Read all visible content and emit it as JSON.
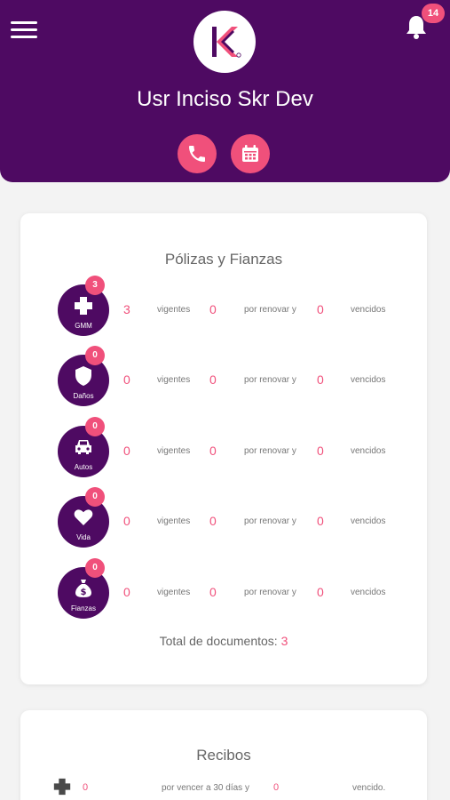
{
  "header": {
    "user_name": "Usr Inciso Skr Dev",
    "notifications_count": "14",
    "logo_letter": "K",
    "colors": {
      "primary": "#4e0a62",
      "accent": "#f0507b"
    }
  },
  "polizas": {
    "title": "Pólizas y Fianzas",
    "vigentes_label": "vigentes",
    "renovar_label": "por renovar y",
    "vencidos_label": "vencidos",
    "rows": [
      {
        "name": "GMM",
        "icon": "medical-cross-icon",
        "badge": "3",
        "vigentes": "3",
        "renovar": "0",
        "vencidos": "0"
      },
      {
        "name": "Daños",
        "icon": "shield-icon",
        "badge": "0",
        "vigentes": "0",
        "renovar": "0",
        "vencidos": "0"
      },
      {
        "name": "Autos",
        "icon": "car-icon",
        "badge": "0",
        "vigentes": "0",
        "renovar": "0",
        "vencidos": "0"
      },
      {
        "name": "Vida",
        "icon": "heart-icon",
        "badge": "0",
        "vigentes": "0",
        "renovar": "0",
        "vencidos": "0"
      },
      {
        "name": "Fianzas",
        "icon": "money-bag-icon",
        "badge": "0",
        "vigentes": "0",
        "renovar": "0",
        "vencidos": "0"
      }
    ],
    "total_label": "Total de documentos:",
    "total_value": "3"
  },
  "recibos": {
    "title": "Recibos",
    "row": {
      "icon": "medical-cross-icon",
      "value1": "0",
      "label1": "por vencer a 30 días y",
      "value2": "0",
      "label2": "vencido."
    }
  }
}
